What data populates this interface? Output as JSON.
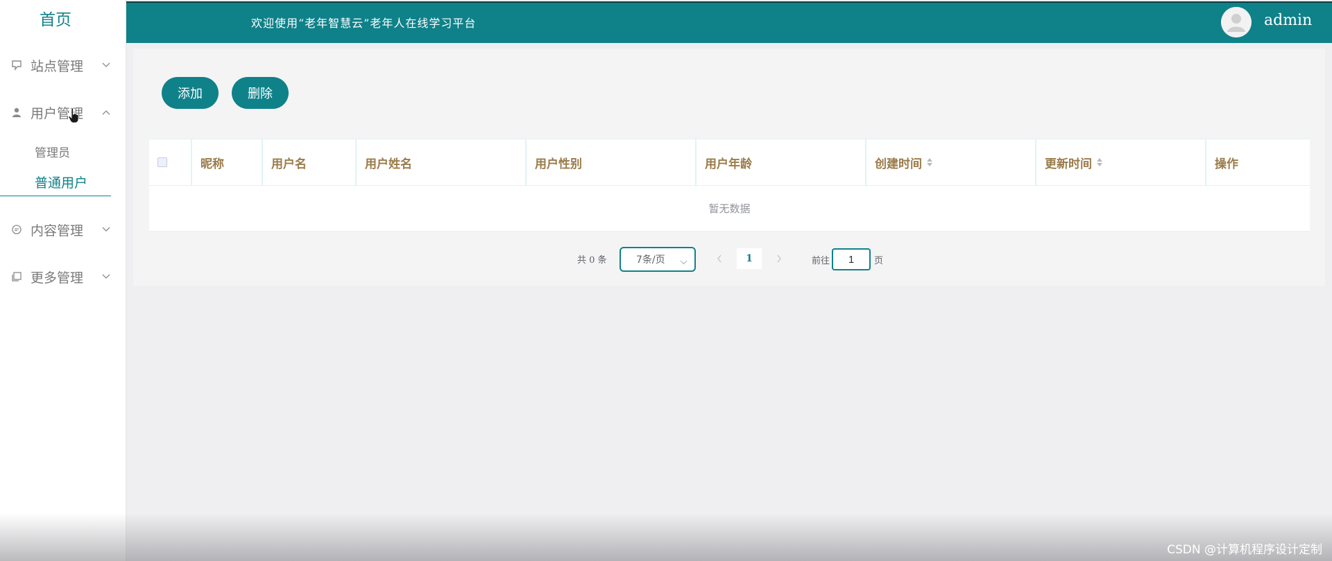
{
  "sidebar": {
    "home": "首页",
    "menus": [
      {
        "label": "站点管理",
        "icon": "monitor-icon"
      },
      {
        "label": "用户管理",
        "icon": "user-icon"
      },
      {
        "label": "内容管理",
        "icon": "chat-icon"
      },
      {
        "label": "更多管理",
        "icon": "copy-icon"
      }
    ],
    "user_submenu": [
      {
        "label": "管理员"
      },
      {
        "label": "普通用户",
        "active": true
      }
    ]
  },
  "header": {
    "welcome": "欢迎使用“老年智慧云”老年人在线学习平台",
    "username": "admin"
  },
  "toolbar": {
    "add_label": "添加",
    "delete_label": "删除"
  },
  "table": {
    "columns": [
      "昵称",
      "用户名",
      "用户姓名",
      "用户性别",
      "用户年龄",
      "创建时间",
      "更新时间",
      "操作"
    ],
    "empty_text": "暂无数据"
  },
  "pagination": {
    "total_text": "共 0 条",
    "page_size": "7条/页",
    "current_page": "1",
    "goto_label": "前往",
    "goto_value": "1",
    "goto_suffix": "页"
  },
  "watermark": "CSDN @计算机程序设计定制",
  "colors": {
    "primary": "#0f8189",
    "header_text": "#9a7b4a"
  }
}
